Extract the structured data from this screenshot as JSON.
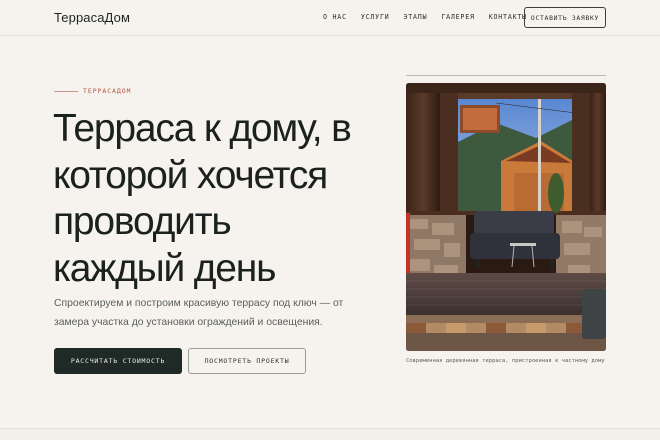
{
  "header": {
    "logo": "ТеррасаДом",
    "nav": [
      {
        "label": "О НАС"
      },
      {
        "label": "УСЛУГИ"
      },
      {
        "label": "ЭТАПЫ"
      },
      {
        "label": "ГАЛЕРЕЯ"
      },
      {
        "label": "КОНТАКТЫ"
      }
    ],
    "cta_label": "ОСТАВИТЬ ЗАЯВКУ"
  },
  "hero": {
    "eyebrow": "ТЕРРАСАДОМ",
    "headline_lines": [
      "Терраса к дому, в",
      "которой хочется",
      "проводить",
      "каждый день"
    ],
    "lead": "Спроектируем и построим красивую террасу под ключ — от замера участка до установки ограждений и освещения.",
    "primary_button": "РАССЧИТАТЬ СТОИМОСТЬ",
    "secondary_button": "ПОСМОТРЕТЬ ПРОЕКТЫ"
  },
  "photo": {
    "caption": "Современная деревянная терраса, пристроенная к частному дому"
  },
  "colors": {
    "background": "#f6f3ee",
    "text": "#1d2320",
    "accent": "#b6553f",
    "primary_button": "#1f2a26"
  }
}
